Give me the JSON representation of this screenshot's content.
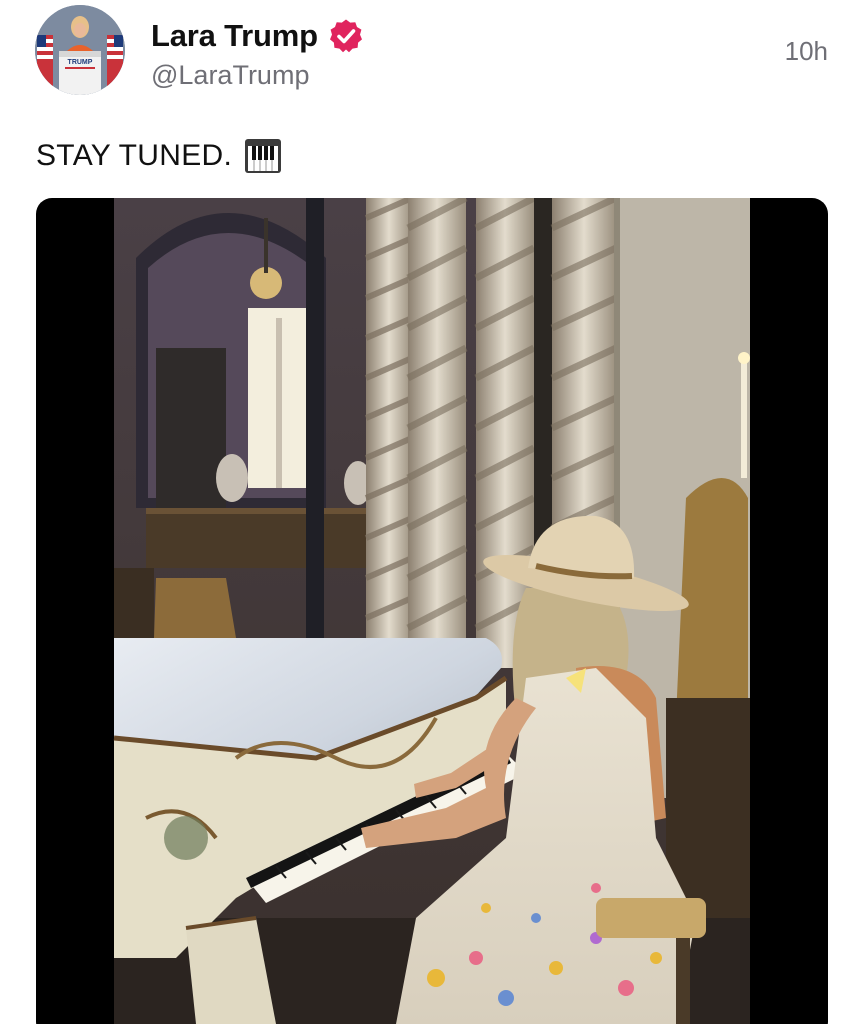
{
  "post": {
    "author": {
      "display_name": "Lara Trump",
      "handle": "@LaraTrump",
      "verified": true,
      "avatar_icon": "avatar-photo",
      "avatar_sign_text": "TRUMP"
    },
    "timestamp": "10h",
    "text": "STAY TUNED.",
    "emoji": "musical-keyboard-icon",
    "media": {
      "type": "video-thumbnail"
    }
  },
  "colors": {
    "verified_badge": "#e0245e",
    "secondary_text": "#6f6f76",
    "primary_text": "#111111"
  }
}
